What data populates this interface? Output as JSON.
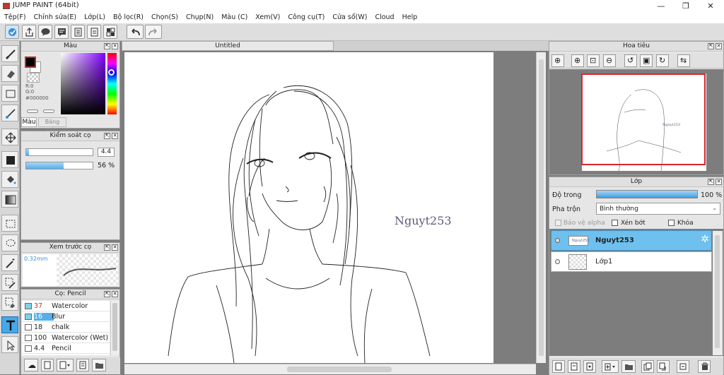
{
  "window": {
    "title": "JUMP PAINT (64bit)",
    "min": "—",
    "max": "❐",
    "close": "✕"
  },
  "menu": [
    "Tệp(F)",
    "Chỉnh sửa(E)",
    "Lớp(L)",
    "Bộ lọc(R)",
    "Chọn(S)",
    "Chụp(N)",
    "Màu (C)",
    "Xem(V)",
    "Công cụ(T)",
    "Cửa sổ(W)",
    "Cloud",
    "Help"
  ],
  "color_panel": {
    "title": "Màu",
    "r": "R:0",
    "g": "G:0",
    "hex": "#000000",
    "tab_color": "Màu",
    "tab_palette": "Bảng màu",
    "foreground": "#000000",
    "background": "#ffffff"
  },
  "brush_control": {
    "title": "Kiểm soát cọ",
    "size_value": "4.4",
    "opacity_value": "56 %",
    "opacity": 0.56,
    "size_fraction": 0.04
  },
  "brush_preview": {
    "title": "Xem trước cọ",
    "size_label": "0.32mm"
  },
  "brush_list": {
    "title": "Cọ: Pencil",
    "items": [
      {
        "size": "37",
        "name": "Watercolor",
        "color": "#7fd3e8",
        "selected": false
      },
      {
        "size": "16",
        "name": "Blur",
        "color": "#e86fc1",
        "selected": false
      },
      {
        "size": "18",
        "name": "chalk",
        "color": "#e8d21b",
        "selected": false
      },
      {
        "size": "100",
        "name": "Watercolor (Wet)",
        "color": "#7fd3e8",
        "selected": false
      },
      {
        "size": "4.4",
        "name": "Pencil",
        "color": "#222222",
        "selected": true
      }
    ]
  },
  "document": {
    "tab": "Untitled",
    "signature": "Nguyt253"
  },
  "navigator": {
    "title": "Hoa tiêu"
  },
  "layers": {
    "title": "Lớp",
    "opacity_label": "Độ trong",
    "opacity_value": "100 %",
    "opacity": 1.0,
    "blend_label": "Pha trộn",
    "blend_value": "Bình thường",
    "alpha_lock": "Bảo vệ alpha",
    "clip": "Xén bớt",
    "lock": "Khóa",
    "items": [
      {
        "name": "Nguyt253",
        "selected": true
      },
      {
        "name": "Lớp1",
        "selected": false
      }
    ]
  }
}
